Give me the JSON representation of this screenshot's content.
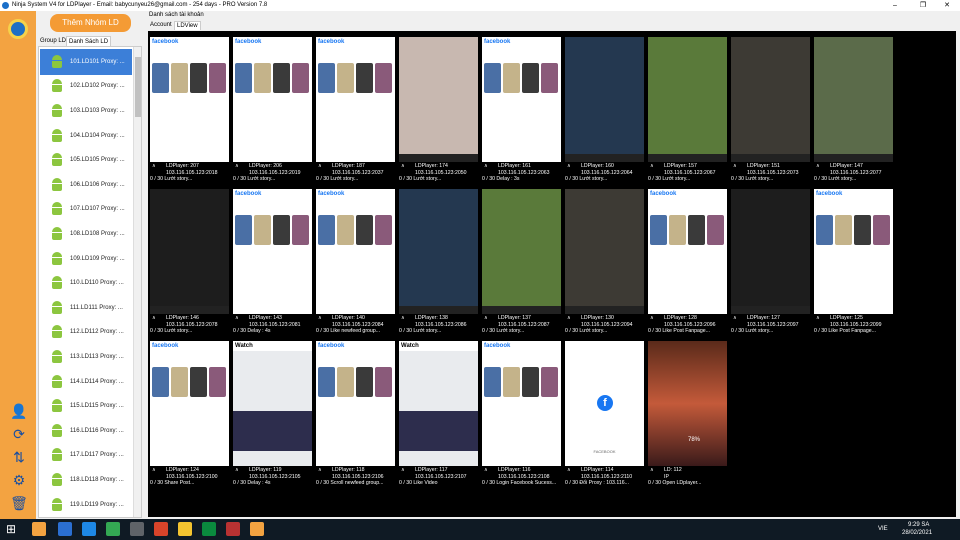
{
  "window": {
    "title": "Ninja System V4 for LDPlayer - Email: babycunyeu26@gmail.com - 254 days - PRO Version 7.8",
    "controls": [
      "–",
      "❐",
      "✕"
    ]
  },
  "left_panel": {
    "add_group_label": "Thêm Nhóm LD",
    "tabs": [
      {
        "label": "Group LD",
        "active": false
      },
      {
        "label": "Danh Sách LD",
        "active": true
      }
    ],
    "items": [
      {
        "label": "101.LD101 Proxy: ...",
        "selected": true
      },
      {
        "label": "102.LD102 Proxy: ..."
      },
      {
        "label": "103.LD103 Proxy: ..."
      },
      {
        "label": "104.LD104 Proxy: ..."
      },
      {
        "label": "105.LD105 Proxy: ..."
      },
      {
        "label": "106.LD106 Proxy: ..."
      },
      {
        "label": "107.LD107 Proxy: ..."
      },
      {
        "label": "108.LD108 Proxy: ..."
      },
      {
        "label": "109.LD109 Proxy: ..."
      },
      {
        "label": "110.LD110 Proxy: ..."
      },
      {
        "label": "111.LD111 Proxy: ..."
      },
      {
        "label": "112.LD112 Proxy: ..."
      },
      {
        "label": "113.LD113 Proxy: ..."
      },
      {
        "label": "114.LD114 Proxy: ..."
      },
      {
        "label": "115.LD115 Proxy: ..."
      },
      {
        "label": "116.LD116 Proxy: ..."
      },
      {
        "label": "117.LD117 Proxy: ..."
      },
      {
        "label": "118.LD118 Proxy: ..."
      },
      {
        "label": "119.LD119 Proxy: ..."
      }
    ]
  },
  "sidebar_tools": [
    "user-settings-icon",
    "refresh-icon",
    "sort-icon",
    "gear-icon",
    "trash-icon"
  ],
  "main": {
    "section_label": "Danh sách tài khoản",
    "tabs": [
      {
        "label": "Account",
        "active": false
      },
      {
        "label": "LDView",
        "active": true
      }
    ]
  },
  "tiles": [
    {
      "name": "LDPlayer: 207",
      "ip": "103.116.105.123:2018",
      "status": "0 / 30   Lướt story...",
      "screen": "facebook"
    },
    {
      "name": "LDPlayer: 206",
      "ip": "103.116.105.123:2019",
      "status": "0 / 30   Lướt story...",
      "screen": "facebook"
    },
    {
      "name": "LDPlayer: 187",
      "ip": "103.116.105.123:2037",
      "status": "0 / 30   Lướt story...",
      "screen": "facebook"
    },
    {
      "name": "LDPlayer: 174",
      "ip": "103.116.105.123:2050",
      "status": "0 / 30   Lướt story...",
      "screen": "video"
    },
    {
      "name": "LDPlayer: 161",
      "ip": "103.116.105.123:2063",
      "status": "0 / 30   Delay : 3s",
      "screen": "facebook"
    },
    {
      "name": "LDPlayer: 160",
      "ip": "103.116.105.123:2064",
      "status": "0 / 30   Lướt story...",
      "screen": "video"
    },
    {
      "name": "LDPlayer: 157",
      "ip": "103.116.105.123:2067",
      "status": "0 / 30   Lướt story...",
      "screen": "video"
    },
    {
      "name": "LDPlayer: 151",
      "ip": "103.116.105.123:2073",
      "status": "0 / 30   Lướt story...",
      "screen": "video"
    },
    {
      "name": "LDPlayer: 147",
      "ip": "103.116.105.123:2077",
      "status": "0 / 30   Lướt story...",
      "screen": "video"
    },
    {
      "name": "LDPlayer: 146",
      "ip": "103.116.105.123:2078",
      "status": "0 / 30   Lướt story...",
      "screen": "video"
    },
    {
      "name": "LDPlayer: 143",
      "ip": "103.116.105.123:2081",
      "status": "0 / 30   Delay : 4s",
      "screen": "facebook"
    },
    {
      "name": "LDPlayer: 140",
      "ip": "103.116.105.123:2084",
      "status": "0 / 30   Like newfeed group...",
      "screen": "facebook"
    },
    {
      "name": "LDPlayer: 138",
      "ip": "103.116.105.123:2086",
      "status": "0 / 30   Lướt story...",
      "screen": "video"
    },
    {
      "name": "LDPlayer: 137",
      "ip": "103.116.105.123:2087",
      "status": "0 / 30   Lướt story...",
      "screen": "video"
    },
    {
      "name": "LDPlayer: 130",
      "ip": "103.116.105.123:2094",
      "status": "0 / 30   Lướt story...",
      "screen": "video"
    },
    {
      "name": "LDPlayer: 128",
      "ip": "103.116.105.123:2096",
      "status": "0 / 30   Like Post Fanpage...",
      "screen": "facebook"
    },
    {
      "name": "LDPlayer: 127",
      "ip": "103.116.105.123:2097",
      "status": "0 / 30   Lướt story...",
      "screen": "video"
    },
    {
      "name": "LDPlayer: 125",
      "ip": "103.116.105.123:2099",
      "status": "0 / 30   Like Post Fanpage...",
      "screen": "facebook"
    },
    {
      "name": "LDPlayer: 124",
      "ip": "103.116.105.123:2100",
      "status": "0 / 30   Share Post...",
      "screen": "facebook"
    },
    {
      "name": "LDPlayer: 119",
      "ip": "103.116.105.123:2105",
      "status": "0 / 30   Delay : 4s",
      "screen": "watch"
    },
    {
      "name": "LDPlayer: 118",
      "ip": "103.116.105.123:2106",
      "status": "0 / 30   Scroll newfeed group...",
      "screen": "facebook"
    },
    {
      "name": "LDPlayer: 117",
      "ip": "103.116.105.123:2107",
      "status": "0 / 30   Like Video",
      "screen": "watch"
    },
    {
      "name": "LDPlayer: 116",
      "ip": "103.116.105.123:2108",
      "status": "0 / 30   Login Facebook Sucess...",
      "screen": "facebook"
    },
    {
      "name": "LDPlayer: 114",
      "ip": "103.116.105.123:2110",
      "status": "0 / 30   Đổi Proxy : 103.116...",
      "screen": "fb-loading"
    },
    {
      "name": "LD: 112",
      "ip": "IP",
      "status": "0 / 30   Open LDplayer...",
      "screen": "game"
    }
  ],
  "taskbar": {
    "time": "9:29 SA",
    "date": "28/02/2021",
    "lang": "VIE",
    "fb_splash_label": "FACEBOOK",
    "game_progress": "78%"
  }
}
